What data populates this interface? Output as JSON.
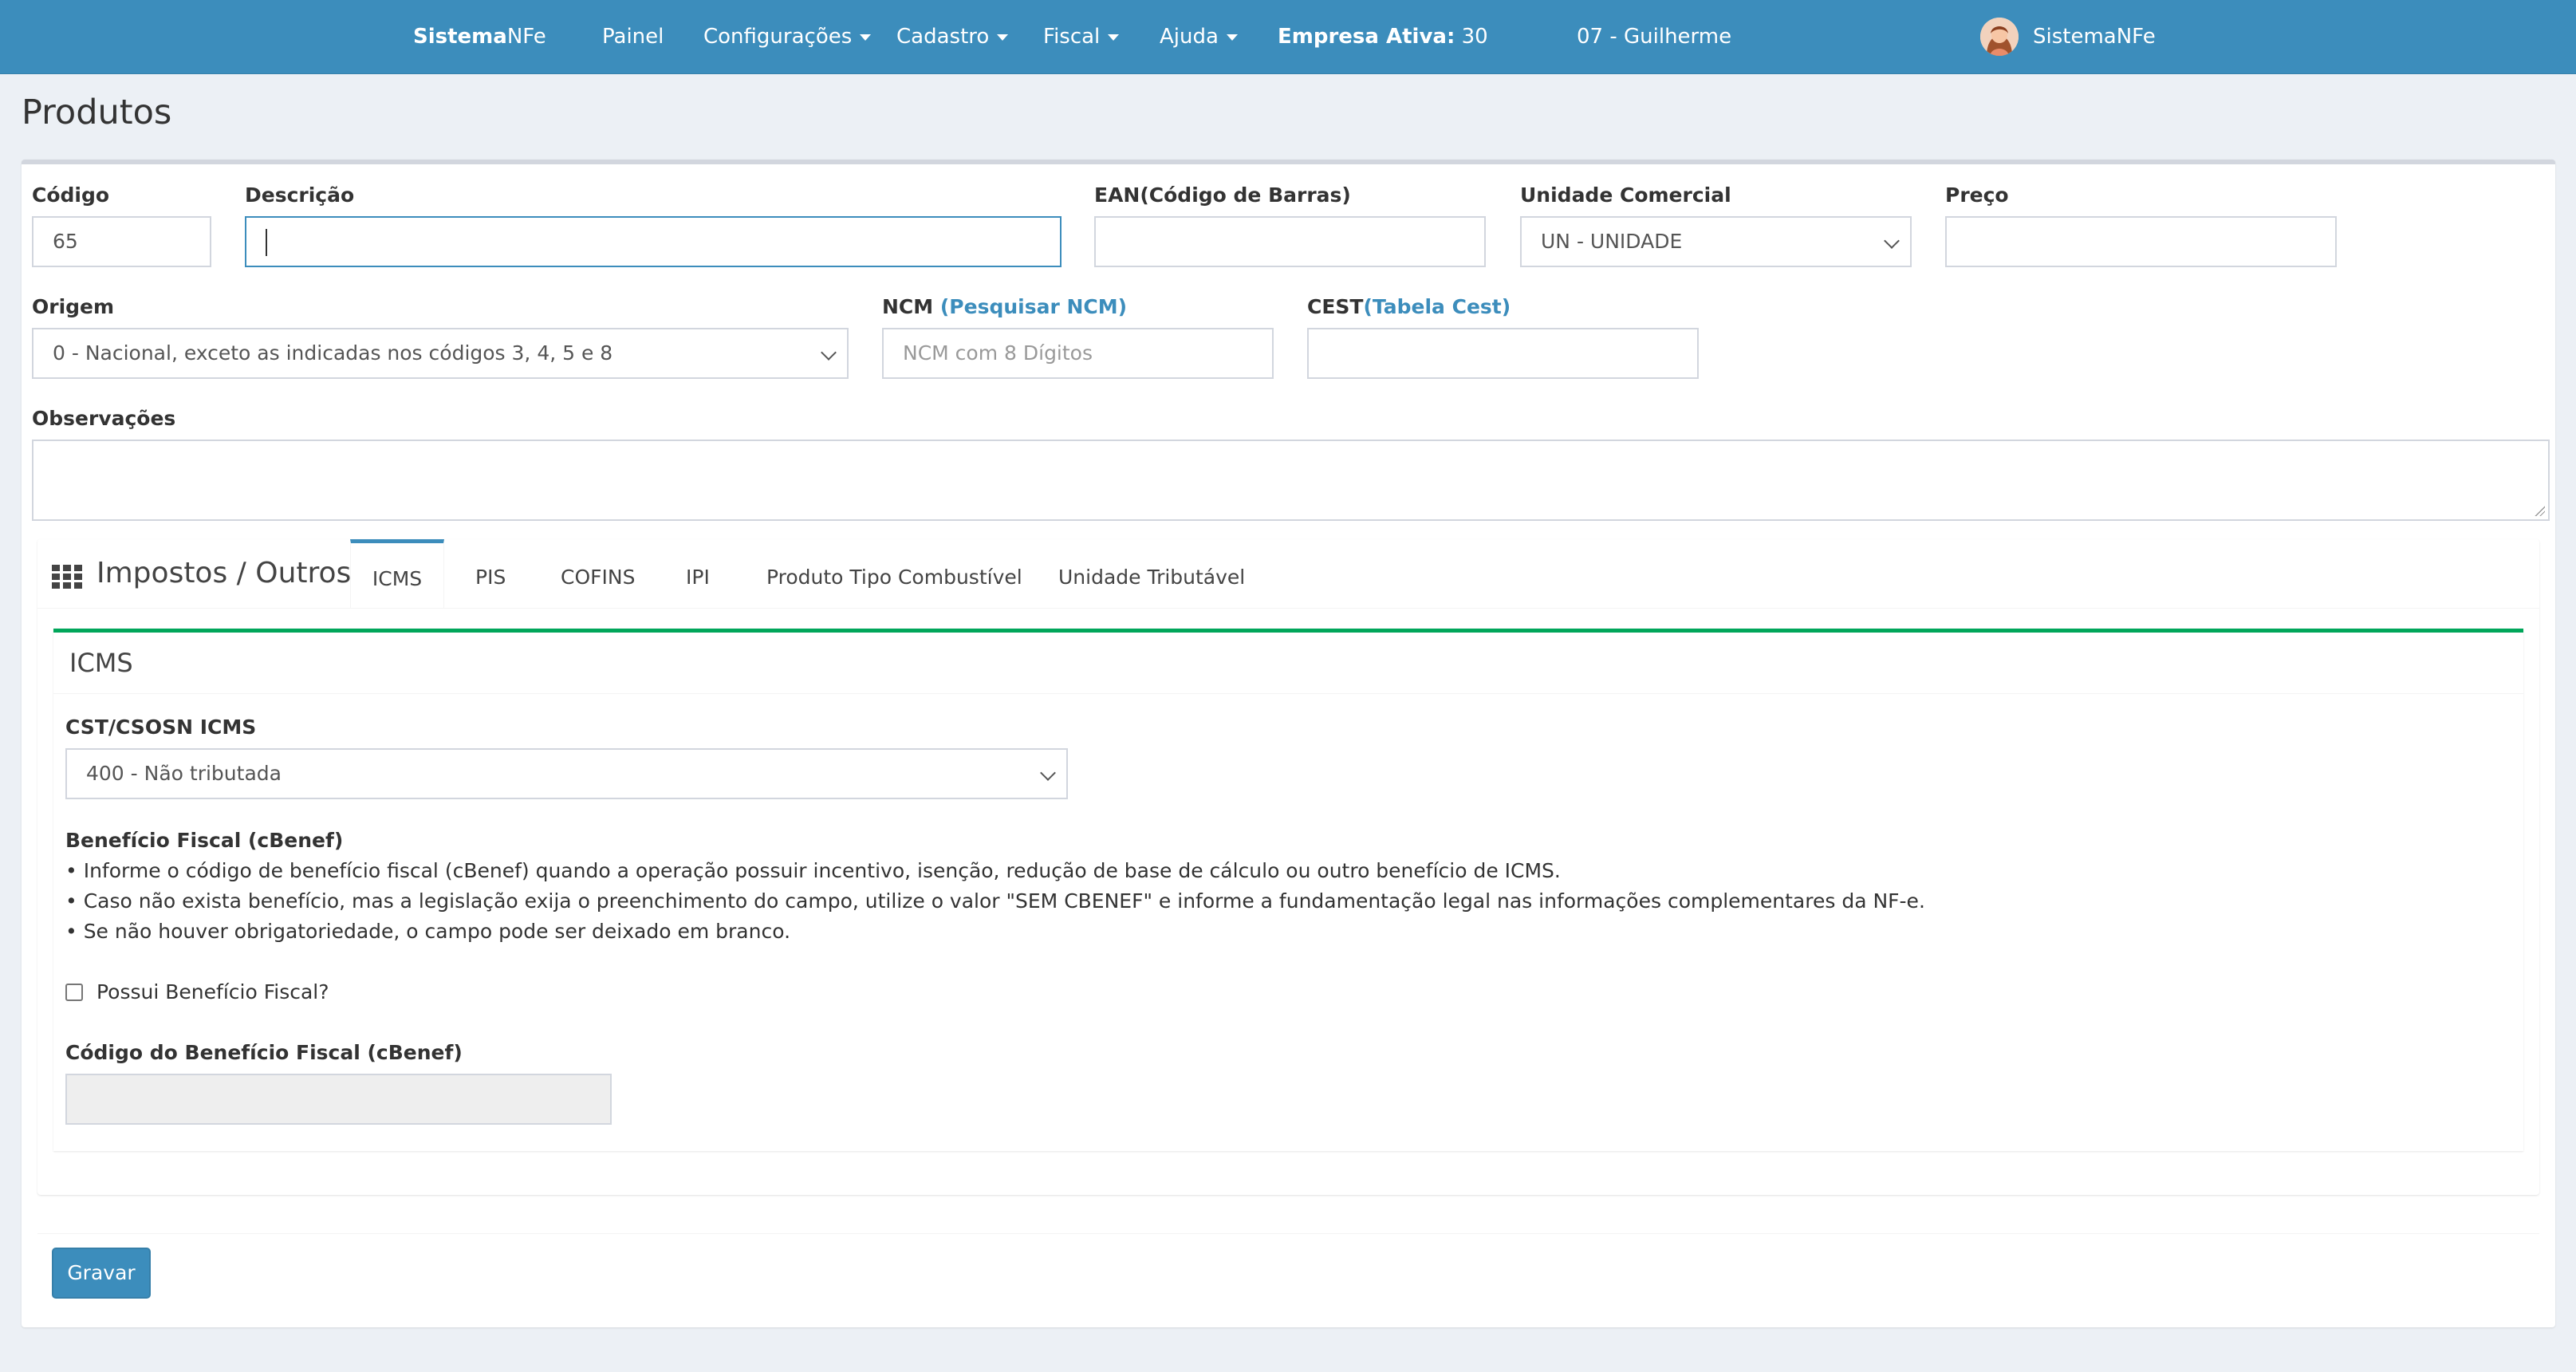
{
  "nav": {
    "brand_bold": "Sistema",
    "brand_rest": "NFe",
    "items": [
      "Painel",
      "Configurações",
      "Cadastro",
      "Fiscal",
      "Ajuda"
    ],
    "empresa_label": "Empresa Ativa:",
    "empresa_value": "30",
    "user_company": "07 - Guilherme",
    "user_name": "SistemaNFe"
  },
  "page": {
    "title": "Produtos"
  },
  "form": {
    "codigo": {
      "label": "Código",
      "value": "65"
    },
    "descricao": {
      "label": "Descrição",
      "value": ""
    },
    "ean": {
      "label": "EAN(Código de Barras)",
      "value": ""
    },
    "unidade": {
      "label": "Unidade Comercial",
      "value": "UN - UNIDADE"
    },
    "preco": {
      "label": "Preço",
      "value": ""
    },
    "origem": {
      "label": "Origem",
      "value": "0 - Nacional, exceto as indicadas nos códigos 3, 4, 5 e 8"
    },
    "ncm": {
      "label": "NCM",
      "link": "(Pesquisar NCM)",
      "placeholder": "NCM com 8 Dígitos"
    },
    "cest": {
      "label": "CEST",
      "link": "(Tabela Cest)",
      "value": ""
    },
    "observacoes": {
      "label": "Observações"
    }
  },
  "tabs": {
    "title": "Impostos / Outros",
    "items": [
      "ICMS",
      "PIS",
      "COFINS",
      "IPI",
      "Produto Tipo Combustível",
      "Unidade Tributável"
    ],
    "active": "ICMS"
  },
  "icms": {
    "title": "ICMS",
    "cst_label": "CST/CSOSN ICMS",
    "cst_value": "400 - Não tributada",
    "beneficio_title": "Benefício Fiscal (cBenef)",
    "beneficio_lines": [
      "• Informe o código de benefício fiscal (cBenef) quando a operação possuir incentivo, isenção, redução de base de cálculo ou outro benefício de ICMS.",
      "• Caso não exista benefício, mas a legislação exija o preenchimento do campo, utilize o valor \"SEM CBENEF\" e informe a fundamentação legal nas informações complementares da NF-e.",
      "• Se não houver obrigatoriedade, o campo pode ser deixado em branco."
    ],
    "checkbox_label": "Possui Benefício Fiscal?",
    "checkbox_checked": false,
    "cbenef_label": "Código do Benefício Fiscal (cBenef)"
  },
  "actions": {
    "save": "Gravar"
  }
}
